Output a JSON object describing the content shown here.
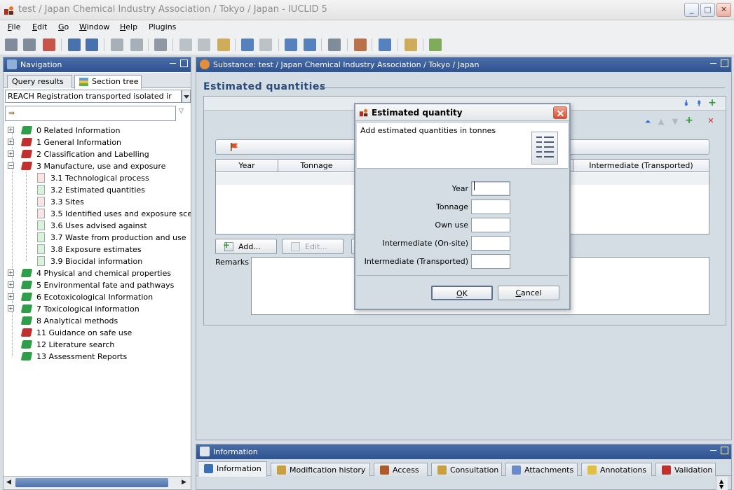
{
  "window": {
    "title": "test / Japan Chemical Industry Association / Tokyo / Japan - IUCLID 5",
    "controls": {
      "minimize": "_",
      "maximize": "□",
      "close": "✕"
    }
  },
  "menu": [
    {
      "label": "File",
      "mnemonic": "F",
      "rest": "ile"
    },
    {
      "label": "Edit",
      "mnemonic": "E",
      "rest": "dit"
    },
    {
      "label": "Go",
      "mnemonic": "G",
      "rest": "o"
    },
    {
      "label": "Window",
      "mnemonic": "W",
      "rest": "indow"
    },
    {
      "label": "Help",
      "mnemonic": "H",
      "rest": "elp"
    },
    {
      "label": "Plugins",
      "mnemonic": "",
      "rest": "Plugins"
    }
  ],
  "toolbar_icons": [
    {
      "icon": "back-arrow-icon",
      "color": "#6c7a8a"
    },
    {
      "icon": "forward-arrow-icon",
      "color": "#6c7a8a"
    },
    {
      "icon": "home-icon",
      "color": "#c0392b"
    },
    {
      "icon": "save-icon",
      "color": "#2c5aa0"
    },
    {
      "icon": "save-all-icon",
      "color": "#2c5aa0"
    },
    {
      "icon": "edit-icon",
      "color": "#9aa4ae"
    },
    {
      "icon": "print-preview-icon",
      "color": "#9aa4ae"
    },
    {
      "icon": "print-icon",
      "color": "#7f8a95"
    },
    {
      "icon": "cut-icon",
      "color": "#b0b8c0"
    },
    {
      "icon": "copy-icon",
      "color": "#b0b8c0"
    },
    {
      "icon": "paste-icon",
      "color": "#c8a040"
    },
    {
      "icon": "undo-icon",
      "color": "#3a6eb5"
    },
    {
      "icon": "redo-icon",
      "color": "#b0b8c0"
    },
    {
      "icon": "report-icon",
      "color": "#3a6eb5"
    },
    {
      "icon": "help-icon",
      "color": "#3a6eb5"
    },
    {
      "icon": "view-icon",
      "color": "#6c7a8a"
    },
    {
      "icon": "plugin-icon",
      "color": "#b05a2a"
    },
    {
      "icon": "validation-icon",
      "color": "#3a6eb5"
    },
    {
      "icon": "notes-icon",
      "color": "#c8a040"
    },
    {
      "icon": "export-icon",
      "color": "#6aa040"
    }
  ],
  "navigation": {
    "title": "Navigation",
    "tabs": [
      "Query results",
      "Section tree"
    ],
    "filter_value": "REACH Registration transported isolated ir",
    "tree": [
      {
        "label": "0 Related Information",
        "level": 0,
        "expander": "+",
        "book_color": "#2f9e4a"
      },
      {
        "label": "1 General Information",
        "level": 0,
        "expander": "+",
        "book_color": "#c0302c"
      },
      {
        "label": "2 Classification and Labelling",
        "level": 0,
        "expander": "+",
        "book_color": "#c0302c"
      },
      {
        "label": "3 Manufacture, use and exposure",
        "level": 0,
        "expander": "−",
        "book_color": "#c0302c"
      },
      {
        "label": "3.1 Technological process",
        "level": 1,
        "page_color": "#fde2e6"
      },
      {
        "label": "3.2 Estimated quantities",
        "level": 1,
        "page_color": "#d9f2d9"
      },
      {
        "label": "3.3 Sites",
        "level": 1,
        "page_color": "#fde2e6"
      },
      {
        "label": "3.5 Identified uses and exposure scer",
        "level": 1,
        "page_color": "#fde2e6"
      },
      {
        "label": "3.6 Uses advised against",
        "level": 1,
        "page_color": "#d9f2d9"
      },
      {
        "label": "3.7 Waste from production and use",
        "level": 1,
        "page_color": "#d9f2d9"
      },
      {
        "label": "3.8 Exposure estimates",
        "level": 1,
        "page_color": "#d9f2d9"
      },
      {
        "label": "3.9 Biocidal information",
        "level": 1,
        "page_color": "#d9f2d9"
      },
      {
        "label": "4 Physical and chemical properties",
        "level": 0,
        "expander": "+",
        "book_color": "#2f9e4a"
      },
      {
        "label": "5 Environmental fate and pathways",
        "level": 0,
        "expander": "+",
        "book_color": "#2f9e4a"
      },
      {
        "label": "6 Ecotoxicological Information",
        "level": 0,
        "expander": "+",
        "book_color": "#2f9e4a"
      },
      {
        "label": "7 Toxicological information",
        "level": 0,
        "expander": "+",
        "book_color": "#2f9e4a"
      },
      {
        "label": "8 Analytical methods",
        "level": 0,
        "book_color": "#2f9e4a"
      },
      {
        "label": "11 Guidance on safe use",
        "level": 0,
        "book_color": "#c0302c"
      },
      {
        "label": "12 Literature search",
        "level": 0,
        "book_color": "#2f9e4a"
      },
      {
        "label": "13 Assessment Reports",
        "level": 0,
        "book_color": "#2f9e4a"
      }
    ]
  },
  "substance": {
    "title": "Substance: test / Japan Chemical Industry Association / Tokyo / Japan",
    "section_title": "Estimated quantities",
    "table_headers": [
      "Year",
      "Tonnage",
      "Intermediate (Transported)"
    ],
    "buttons": {
      "add": "Add...",
      "edit": "Edit..."
    },
    "remarks_label": "Remarks"
  },
  "dialog": {
    "title": "Estimated quantity",
    "header_text": "Add estimated quantities in tonnes",
    "fields": [
      {
        "label": "Year",
        "value": ""
      },
      {
        "label": "Tonnage",
        "value": ""
      },
      {
        "label": "Own use",
        "value": ""
      },
      {
        "label": "Intermediate (On-site)",
        "value": ""
      },
      {
        "label": "Intermediate (Transported)",
        "value": ""
      }
    ],
    "ok": {
      "mnemonic": "O",
      "rest": "K"
    },
    "cancel": {
      "mnemonic": "C",
      "rest": "ancel"
    }
  },
  "information": {
    "title": "Information",
    "tabs": [
      {
        "label": "Information",
        "icon_color": "#3a6eb5"
      },
      {
        "label": "Modification history",
        "icon_color": "#c8a040"
      },
      {
        "label": "Access",
        "icon_color": "#b05a2a"
      },
      {
        "label": "Consultation",
        "icon_color": "#c8a040"
      },
      {
        "label": "Attachments",
        "icon_color": "#6a8ac8"
      },
      {
        "label": "Annotations",
        "icon_color": "#e0c040"
      },
      {
        "label": "Validation",
        "icon_color": "#c0302c"
      }
    ]
  },
  "colors": {
    "accent": "#2f5290",
    "section_title": "#2a4a7a"
  }
}
